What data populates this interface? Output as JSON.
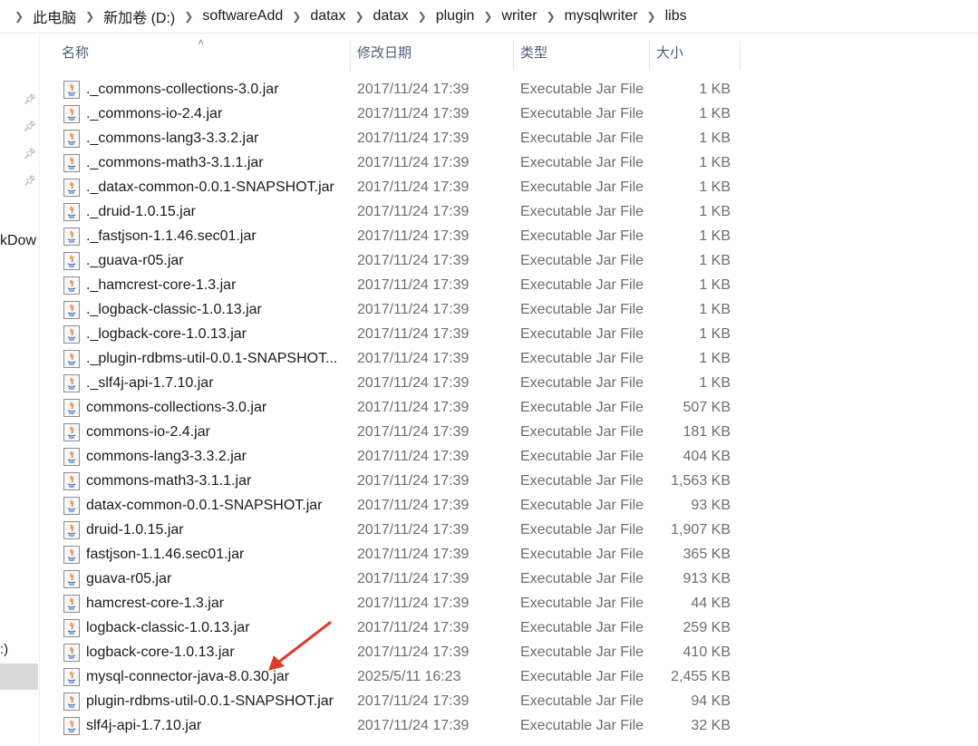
{
  "breadcrumb": [
    "此电脑",
    "新加卷 (D:)",
    "softwareAdd",
    "datax",
    "datax",
    "plugin",
    "writer",
    "mysqlwriter",
    "libs"
  ],
  "nav": {
    "partial_label": "kDow",
    "partial_label2": ":)"
  },
  "columns": {
    "name": "名称",
    "date": "修改日期",
    "type": "类型",
    "size": "大小"
  },
  "files": [
    {
      "name": "._commons-collections-3.0.jar",
      "date": "2017/11/24 17:39",
      "type": "Executable Jar File",
      "size": "1 KB"
    },
    {
      "name": "._commons-io-2.4.jar",
      "date": "2017/11/24 17:39",
      "type": "Executable Jar File",
      "size": "1 KB"
    },
    {
      "name": "._commons-lang3-3.3.2.jar",
      "date": "2017/11/24 17:39",
      "type": "Executable Jar File",
      "size": "1 KB"
    },
    {
      "name": "._commons-math3-3.1.1.jar",
      "date": "2017/11/24 17:39",
      "type": "Executable Jar File",
      "size": "1 KB"
    },
    {
      "name": "._datax-common-0.0.1-SNAPSHOT.jar",
      "date": "2017/11/24 17:39",
      "type": "Executable Jar File",
      "size": "1 KB"
    },
    {
      "name": "._druid-1.0.15.jar",
      "date": "2017/11/24 17:39",
      "type": "Executable Jar File",
      "size": "1 KB"
    },
    {
      "name": "._fastjson-1.1.46.sec01.jar",
      "date": "2017/11/24 17:39",
      "type": "Executable Jar File",
      "size": "1 KB"
    },
    {
      "name": "._guava-r05.jar",
      "date": "2017/11/24 17:39",
      "type": "Executable Jar File",
      "size": "1 KB"
    },
    {
      "name": "._hamcrest-core-1.3.jar",
      "date": "2017/11/24 17:39",
      "type": "Executable Jar File",
      "size": "1 KB"
    },
    {
      "name": "._logback-classic-1.0.13.jar",
      "date": "2017/11/24 17:39",
      "type": "Executable Jar File",
      "size": "1 KB"
    },
    {
      "name": "._logback-core-1.0.13.jar",
      "date": "2017/11/24 17:39",
      "type": "Executable Jar File",
      "size": "1 KB"
    },
    {
      "name": "._plugin-rdbms-util-0.0.1-SNAPSHOT...",
      "date": "2017/11/24 17:39",
      "type": "Executable Jar File",
      "size": "1 KB"
    },
    {
      "name": "._slf4j-api-1.7.10.jar",
      "date": "2017/11/24 17:39",
      "type": "Executable Jar File",
      "size": "1 KB"
    },
    {
      "name": "commons-collections-3.0.jar",
      "date": "2017/11/24 17:39",
      "type": "Executable Jar File",
      "size": "507 KB"
    },
    {
      "name": "commons-io-2.4.jar",
      "date": "2017/11/24 17:39",
      "type": "Executable Jar File",
      "size": "181 KB"
    },
    {
      "name": "commons-lang3-3.3.2.jar",
      "date": "2017/11/24 17:39",
      "type": "Executable Jar File",
      "size": "404 KB"
    },
    {
      "name": "commons-math3-3.1.1.jar",
      "date": "2017/11/24 17:39",
      "type": "Executable Jar File",
      "size": "1,563 KB"
    },
    {
      "name": "datax-common-0.0.1-SNAPSHOT.jar",
      "date": "2017/11/24 17:39",
      "type": "Executable Jar File",
      "size": "93 KB"
    },
    {
      "name": "druid-1.0.15.jar",
      "date": "2017/11/24 17:39",
      "type": "Executable Jar File",
      "size": "1,907 KB"
    },
    {
      "name": "fastjson-1.1.46.sec01.jar",
      "date": "2017/11/24 17:39",
      "type": "Executable Jar File",
      "size": "365 KB"
    },
    {
      "name": "guava-r05.jar",
      "date": "2017/11/24 17:39",
      "type": "Executable Jar File",
      "size": "913 KB"
    },
    {
      "name": "hamcrest-core-1.3.jar",
      "date": "2017/11/24 17:39",
      "type": "Executable Jar File",
      "size": "44 KB"
    },
    {
      "name": "logback-classic-1.0.13.jar",
      "date": "2017/11/24 17:39",
      "type": "Executable Jar File",
      "size": "259 KB"
    },
    {
      "name": "logback-core-1.0.13.jar",
      "date": "2017/11/24 17:39",
      "type": "Executable Jar File",
      "size": "410 KB"
    },
    {
      "name": "mysql-connector-java-8.0.30.jar",
      "date": "2025/5/11 16:23",
      "type": "Executable Jar File",
      "size": "2,455 KB"
    },
    {
      "name": "plugin-rdbms-util-0.0.1-SNAPSHOT.jar",
      "date": "2017/11/24 17:39",
      "type": "Executable Jar File",
      "size": "94 KB"
    },
    {
      "name": "slf4j-api-1.7.10.jar",
      "date": "2017/11/24 17:39",
      "type": "Executable Jar File",
      "size": "32 KB"
    }
  ],
  "icons": {
    "file": "java-jar-icon",
    "pin": "pin-icon",
    "arrow": "red-arrow-annotation"
  },
  "colors": {
    "annotation_arrow": "#e03a2a",
    "header_text": "#4c607a"
  }
}
